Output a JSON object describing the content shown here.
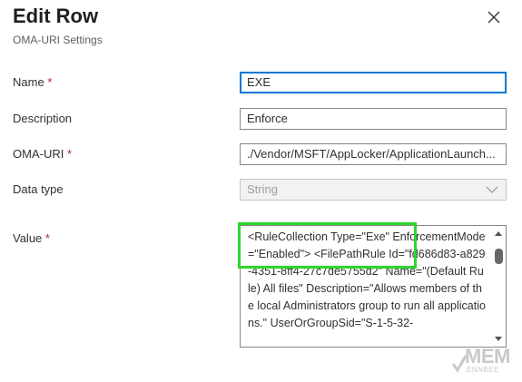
{
  "header": {
    "title": "Edit Row",
    "subtitle": "OMA-URI Settings"
  },
  "form": {
    "name": {
      "label": "Name",
      "required_mark": "*",
      "value": "EXE"
    },
    "description": {
      "label": "Description",
      "value": "Enforce"
    },
    "oma_uri": {
      "label": "OMA-URI",
      "required_mark": "*",
      "value": "./Vendor/MSFT/AppLocker/ApplicationLaunch..."
    },
    "data_type": {
      "label": "Data type",
      "value": "String"
    },
    "value": {
      "label": "Value",
      "required_mark": "*",
      "text": "<RuleCollection Type=\"Exe\" EnforcementMode=\"Enabled\"> <FilePathRule Id=\"fd686d83-a829-4351-8ff4-27c7de5755d2\" Name=\"(Default Rule) All files\" Description=\"Allows members of the local Administrators group to run all applications.\" UserOrGroupSid=\"S-1-5-32-"
    }
  },
  "watermark": {
    "main": "MEM",
    "sub": "ENNBEE"
  },
  "colors": {
    "focus_border": "#0078d4",
    "required": "#a4262c",
    "highlight": "#2ed62e"
  }
}
